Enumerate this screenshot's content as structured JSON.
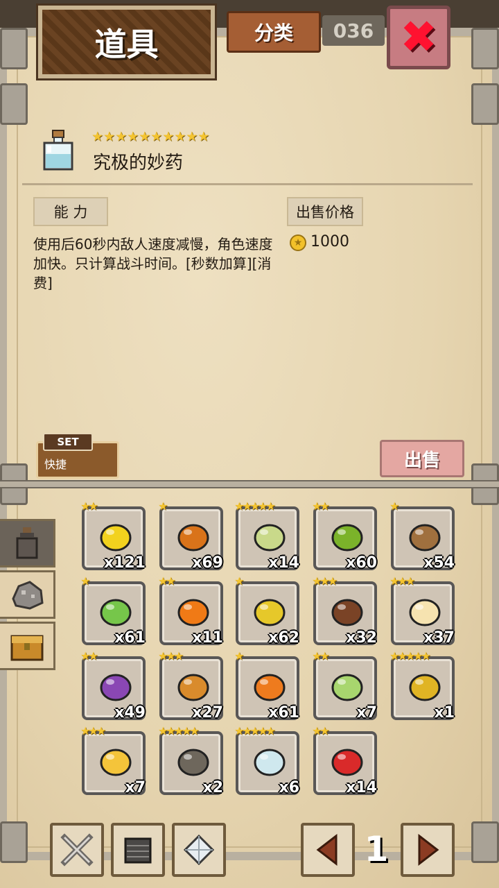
{
  "header": {
    "title": "道具",
    "category_label": "分类",
    "counter_text": "036"
  },
  "detail": {
    "rarity_stars": "★★★★★★★★★★",
    "item_name": "究极的妙药",
    "ability_tag": "能 力",
    "description": "使用后60秒内敌人速度减慢，角色速度加快。只计算战斗时间。[秒数加算][消费]",
    "price_tag": "出售价格",
    "price": "1000",
    "set_badge": "SET",
    "shortcut_label": "快捷",
    "sell_label": "出售"
  },
  "categories": [
    {
      "icon": "potion-icon",
      "active": true
    },
    {
      "icon": "ore-icon",
      "active": false
    },
    {
      "icon": "chest-icon",
      "active": false
    }
  ],
  "items": [
    {
      "name": "lemon",
      "stars": "★★",
      "qty": "x121",
      "color": "#f2d21e"
    },
    {
      "name": "pumpkin",
      "stars": "★",
      "qty": "x69",
      "color": "#d9731a"
    },
    {
      "name": "potion",
      "stars": "★★★★★",
      "qty": "x14",
      "color": "#c9d98a"
    },
    {
      "name": "kiwi",
      "stars": "★★",
      "qty": "x60",
      "color": "#7bb32a"
    },
    {
      "name": "potato",
      "stars": "★",
      "qty": "x54",
      "color": "#a0703e"
    },
    {
      "name": "pepper",
      "stars": "★",
      "qty": "x61",
      "color": "#76c64a"
    },
    {
      "name": "orange",
      "stars": "★★",
      "qty": "x11",
      "color": "#f07a16"
    },
    {
      "name": "corn",
      "stars": "★",
      "qty": "x62",
      "color": "#e6c82a"
    },
    {
      "name": "chocolate",
      "stars": "★★★",
      "qty": "x32",
      "color": "#7a4326"
    },
    {
      "name": "cake",
      "stars": "★★★",
      "qty": "x37",
      "color": "#f6e3b0"
    },
    {
      "name": "grapes",
      "stars": "★★",
      "qty": "x49",
      "color": "#8a47b4"
    },
    {
      "name": "bread",
      "stars": "★★★",
      "qty": "x27",
      "color": "#d98b2c"
    },
    {
      "name": "carrot",
      "stars": "★",
      "qty": "x61",
      "color": "#ee7b1e"
    },
    {
      "name": "melon",
      "stars": "★★",
      "qty": "x7",
      "color": "#a8d66e"
    },
    {
      "name": "gold-card",
      "stars": "★★★★★",
      "qty": "x1",
      "color": "#e0b424"
    },
    {
      "name": "omelette",
      "stars": "★★★",
      "qty": "x7",
      "color": "#f4c43a"
    },
    {
      "name": "anvil",
      "stars": "★★★★★",
      "qty": "x2",
      "color": "#6e675c"
    },
    {
      "name": "elixir",
      "stars": "★★★★★",
      "qty": "x6",
      "color": "#cfe8ee"
    },
    {
      "name": "apple",
      "stars": "★★",
      "qty": "x14",
      "color": "#d92a2a"
    }
  ],
  "bottom": {
    "page": "1"
  }
}
